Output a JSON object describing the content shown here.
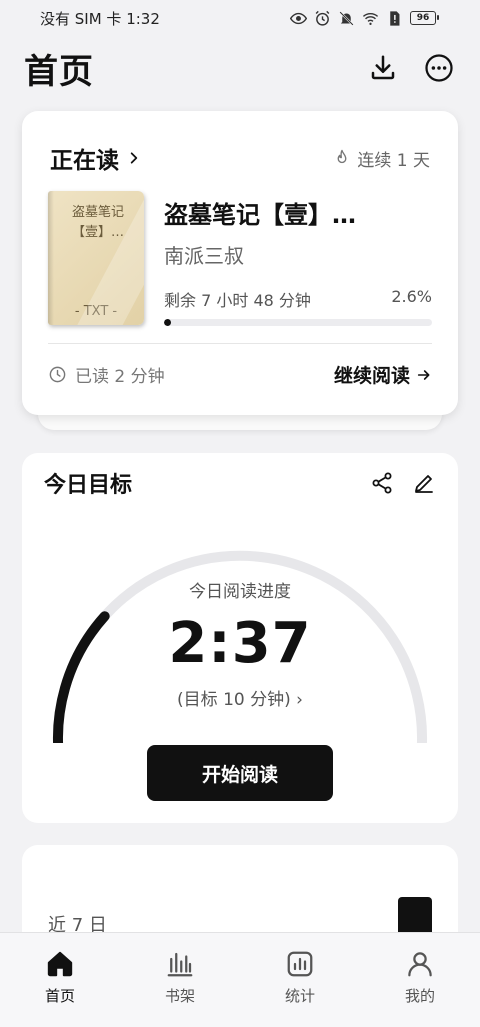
{
  "status_bar": {
    "carrier_time": "没有 SIM 卡 1:32",
    "battery": "96"
  },
  "header": {
    "title": "首页"
  },
  "reading_card": {
    "title": "正在读",
    "streak": "连续 1 天",
    "cover_title": "盗墓笔记【壹】…",
    "cover_format": "- TXT -",
    "book_title": "盗墓笔记【壹】…",
    "author": "南派三叔",
    "remaining": "剩余 7 小时 48 分钟",
    "progress_text": "2.6%",
    "progress_value": 2.6,
    "read_time": "已读 2 分钟",
    "continue_label": "继续阅读"
  },
  "goal_card": {
    "title": "今日目标",
    "gauge_label": "今日阅读进度",
    "gauge_value": "2:37",
    "target": "(目标 10 分钟)",
    "progress_fraction": 0.26,
    "start_label": "开始阅读"
  },
  "week_card": {
    "label": "近 7 日",
    "bars": [
      0.04,
      0.04,
      0.04,
      0.04,
      0.04,
      0.04,
      1.0
    ]
  },
  "nav": {
    "items": [
      {
        "label": "首页",
        "icon": "home-icon",
        "active": true
      },
      {
        "label": "书架",
        "icon": "bookshelf-icon",
        "active": false
      },
      {
        "label": "统计",
        "icon": "stats-icon",
        "active": false
      },
      {
        "label": "我的",
        "icon": "profile-icon",
        "active": false
      }
    ]
  }
}
